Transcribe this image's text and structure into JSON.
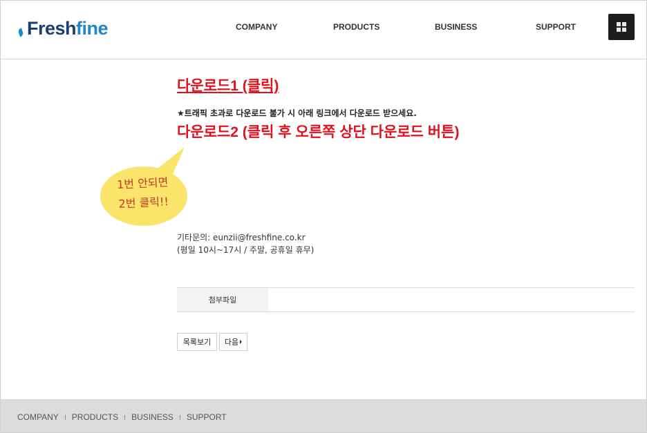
{
  "header": {
    "logo": {
      "part1": "Fresh",
      "part2": "fine"
    },
    "nav": [
      {
        "label": "COMPANY"
      },
      {
        "label": "PRODUCTS"
      },
      {
        "label": "BUSINESS"
      },
      {
        "label": "SUPPORT"
      }
    ],
    "menu_icon": "grid-menu-icon"
  },
  "content": {
    "download1": "다운로드1 (클릭)",
    "notice": "★트래픽 초과로 다운로드 불가 시 아래 링크에서 다운로드 받으세요.",
    "download2": "다운로드2 (클릭 후 오른쪽 상단 다운로드 버튼)",
    "bubble_line1": "1번 안되면",
    "bubble_line2": "2번 클릭!!",
    "contact_line1": "기타문의: eunzii@freshfine.co.kr",
    "contact_line2": "(평일 10시~17시 / 주말, 공휴일 휴무)",
    "attachment_tab": "첨부파일"
  },
  "buttons": {
    "list": "목록보기",
    "next": "다음"
  },
  "footer": {
    "links": [
      {
        "label": "COMPANY"
      },
      {
        "label": "PRODUCTS"
      },
      {
        "label": "BUSINESS"
      },
      {
        "label": "SUPPORT"
      }
    ]
  },
  "colors": {
    "accent_red": "#e3101c",
    "logo_dark": "#1c3f6b",
    "logo_blue": "#1f86c8",
    "bubble_yellow": "#fbe46a"
  }
}
